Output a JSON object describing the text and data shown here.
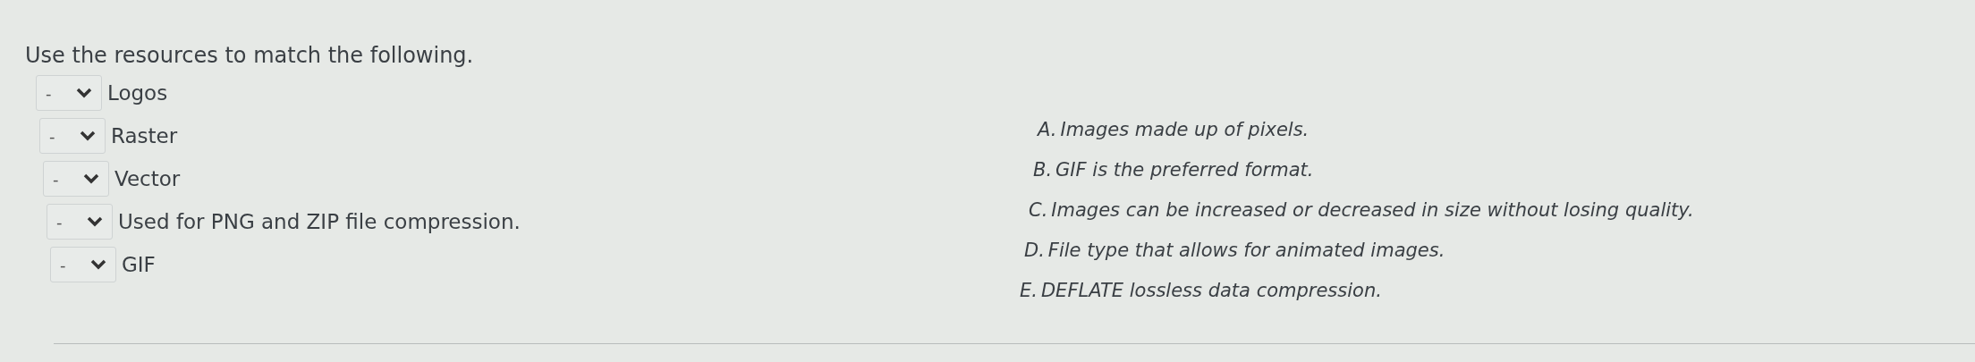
{
  "instruction": "Use the resources to match the following.",
  "items": [
    {
      "answer": "-",
      "label": "Logos"
    },
    {
      "answer": "-",
      "label": "Raster"
    },
    {
      "answer": "-",
      "label": "Vector"
    },
    {
      "answer": "-",
      "label": "Used for PNG and ZIP file compression."
    },
    {
      "answer": "-",
      "label": "GIF"
    }
  ],
  "options": [
    {
      "letter": "A.",
      "text": "Images made up of pixels."
    },
    {
      "letter": "B.",
      "text": "GIF is the preferred format."
    },
    {
      "letter": "C.",
      "text": "Images can be increased or decreased in size without losing quality."
    },
    {
      "letter": "D.",
      "text": "File type that allows for animated images."
    },
    {
      "letter": "E.",
      "text": "DEFLATE lossless data compression."
    }
  ]
}
